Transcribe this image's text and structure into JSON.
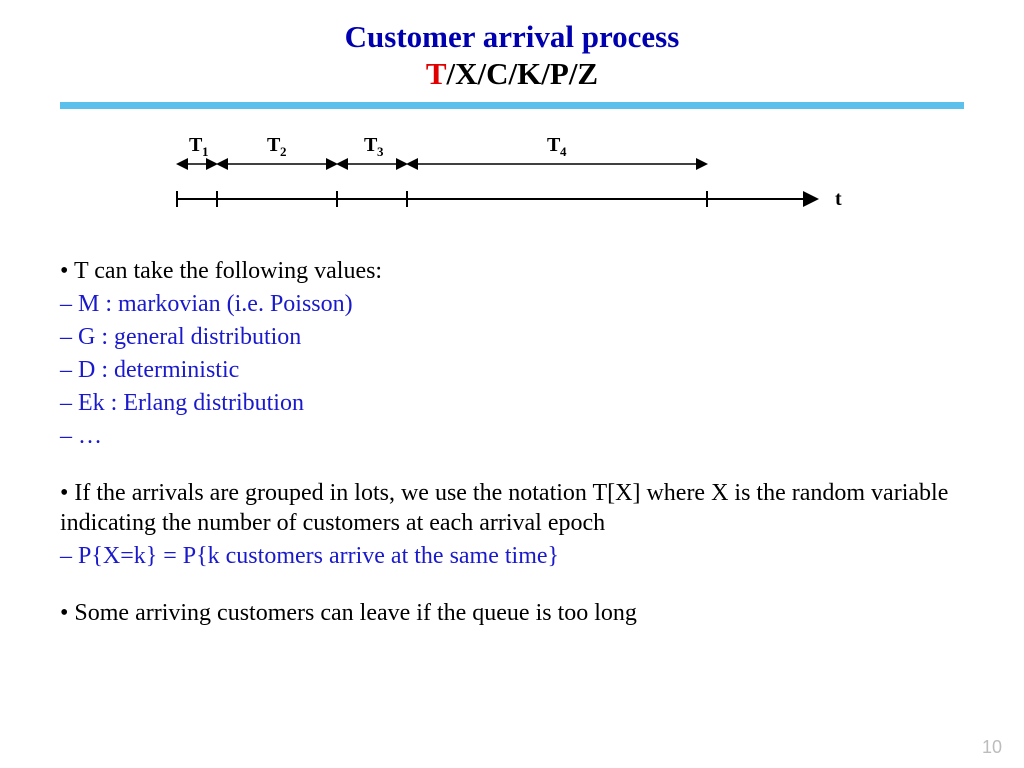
{
  "title": "Customer arrival process",
  "notation": {
    "t": "T",
    "rest": "/X/C/K/P/Z"
  },
  "diagram": {
    "intervals": [
      "T",
      "T",
      "T",
      "T"
    ],
    "subs": [
      "1",
      "2",
      "3",
      "4"
    ],
    "axis_label": "t"
  },
  "bullet1_intro": "• T can take the following values:",
  "bullet1_items": [
    "– M : markovian (i.e. Poisson)",
    "– G : general distribution",
    "– D : deterministic",
    "– Ek : Erlang distribution",
    "– …"
  ],
  "bullet2_text": "• If the arrivals are grouped in lots, we use the notation T[X] where X is the random variable indicating the number of customers at each arrival epoch",
  "bullet2_sub": "– P{X=k} = P{k customers arrive at the same time}",
  "bullet3_text": "• Some arriving customers can leave if the queue is too long",
  "page_number": "10"
}
